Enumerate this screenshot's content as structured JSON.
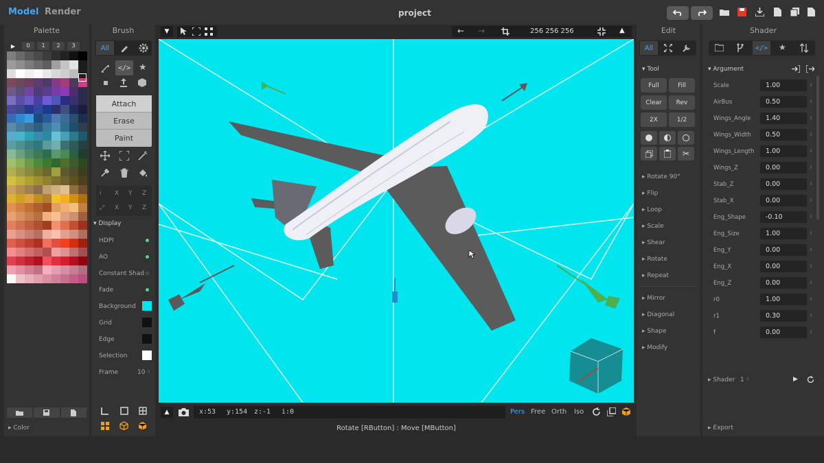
{
  "app": {
    "modes": [
      "Model",
      "Render"
    ],
    "project_title": "project"
  },
  "panels": {
    "palette": "Palette",
    "brush": "Brush",
    "edit": "Edit",
    "shader": "Shader"
  },
  "palette": {
    "pages": [
      "0",
      "1",
      "2",
      "3"
    ],
    "footer": "Color",
    "colors": [
      "#7e7e7e",
      "#6a6a6a",
      "#585858",
      "#4a4a4a",
      "#3c3c3c",
      "#2e2e2e",
      "#222",
      "#111",
      "#000",
      "#9c9c9c",
      "#8e8e8e",
      "#7c7c7c",
      "#6c6c6c",
      "#5e5e5e",
      "#a0a0a0",
      "#c4c4c4",
      "#e2e2e2",
      "#1c1c1c",
      "#dedede",
      "#fff",
      "#f0f0f0",
      "#fafafa",
      "#e8e8e8",
      "#d8d8d8",
      "#cfcfcf",
      "#bdbdbd",
      "#1e1e1e",
      "#7a4a5a",
      "#6a4a5a",
      "#6e3e5e",
      "#5c3e6e",
      "#4e3a6a",
      "#863a86",
      "#a53c7a",
      "#4a3a5c",
      "#d04080",
      "#6c5a8a",
      "#5a4e7a",
      "#6e46a0",
      "#4c3c7a",
      "#5a3e8c",
      "#7a3aa8",
      "#8a3ab2",
      "#4c2e6a",
      "#2e2a4e",
      "#7a6ebe",
      "#5a4eaa",
      "#6a5ac8",
      "#4e3ea0",
      "#6e5cd6",
      "#4a5ab4",
      "#2a2e7e",
      "#3a2e6e",
      "#2a2a4a",
      "#4a4a9a",
      "#3a4a8a",
      "#2a3a8a",
      "#2e4aa0",
      "#1e3a8a",
      "#2e2e6e",
      "#3e4e7e",
      "#1e2a5e",
      "#1a1e3e",
      "#3a6ab0",
      "#2e8ad0",
      "#3e9ae0",
      "#1e4a7e",
      "#2a5a9a",
      "#4a7ab0",
      "#3e6a9a",
      "#2e4e6e",
      "#1e2e4e",
      "#5a8aaa",
      "#4a7a9a",
      "#3e6e8e",
      "#2e5e7e",
      "#3a7a9a",
      "#4e8eae",
      "#2e6e8e",
      "#1e4e6e",
      "#2e3e4e",
      "#5aaad0",
      "#4ab4c8",
      "#2ea0b8",
      "#3a8ab0",
      "#2a8aa0",
      "#6ac0d8",
      "#4aa0b0",
      "#2e7a8a",
      "#1e5a6a",
      "#5aa0a0",
      "#4e9090",
      "#3e8080",
      "#2e7a7a",
      "#5e9a9a",
      "#6eb0b0",
      "#3e7070",
      "#2e5a5a",
      "#2a4040",
      "#8ab89a",
      "#6aa07a",
      "#4e8a6a",
      "#3e7a5a",
      "#2e6e4e",
      "#5a9a6a",
      "#4a8a5a",
      "#2e5e3e",
      "#1e3e2e",
      "#a0c070",
      "#8ab05a",
      "#6a9a4a",
      "#4e8a3e",
      "#3e7a2e",
      "#2e6a2e",
      "#4e6e2e",
      "#3e5a2e",
      "#2e4a1e",
      "#b0b050",
      "#9a9a4a",
      "#8a8a3e",
      "#7a7a2e",
      "#6a6a2e",
      "#a0a03e",
      "#5a5a2e",
      "#4e4e2e",
      "#3e3e1e",
      "#d4c040",
      "#c0b040",
      "#b0a030",
      "#a09030",
      "#908030",
      "#807030",
      "#706030",
      "#605020",
      "#504020",
      "#caa060",
      "#b49050",
      "#a08050",
      "#8a7050",
      "#c0a070",
      "#d0b080",
      "#e0c090",
      "#906e40",
      "#6e5030",
      "#e0b030",
      "#d0a020",
      "#e0a040",
      "#c09020",
      "#b08030",
      "#f0c030",
      "#f0b020",
      "#d09010",
      "#b07010",
      "#e09050",
      "#d08040",
      "#c07030",
      "#b06030",
      "#a05020",
      "#e0a060",
      "#f0b070",
      "#f0c080",
      "#c08040",
      "#e8a070",
      "#d89060",
      "#c88050",
      "#b87040",
      "#f0b080",
      "#f8c090",
      "#e0a080",
      "#d09070",
      "#a06040",
      "#e08060",
      "#d07050",
      "#c06040",
      "#b05030",
      "#a04020",
      "#f09070",
      "#e07050",
      "#c05030",
      "#a03020",
      "#e8a090",
      "#d89080",
      "#c88070",
      "#b87060",
      "#f0b0a0",
      "#f8c0b0",
      "#e0a090",
      "#d09080",
      "#b07060",
      "#e06050",
      "#d05040",
      "#c04030",
      "#b03020",
      "#f07060",
      "#e05040",
      "#f04020",
      "#d03010",
      "#a02010",
      "#f09090",
      "#e08080",
      "#d07070",
      "#c06060",
      "#b05050",
      "#f0a0a0",
      "#e09090",
      "#c07070",
      "#a05050",
      "#e04050",
      "#d03040",
      "#c02030",
      "#b01020",
      "#f05060",
      "#e03040",
      "#d02030",
      "#b01020",
      "#900010",
      "#f0a0b0",
      "#e090a0",
      "#d08090",
      "#c07080",
      "#f0b0c0",
      "#e0a0b0",
      "#d090a0",
      "#c08090",
      "#b07080",
      "#f8f8f8",
      "#f0c0c8",
      "#e8b0b8",
      "#e0a0a8",
      "#d890a0",
      "#d08098",
      "#c87090",
      "#c06088",
      "#b85080"
    ]
  },
  "brush": {
    "tabs": [
      "All"
    ],
    "actions": [
      "Attach",
      "Erase",
      "Paint"
    ],
    "axes1": [
      "X",
      "Y",
      "Z"
    ],
    "axes2": [
      "X",
      "Y",
      "Z"
    ]
  },
  "display": {
    "title": "Display",
    "items": [
      {
        "label": "HDPI"
      },
      {
        "label": "AO"
      },
      {
        "label": "Constant Shad"
      },
      {
        "label": "Fade"
      },
      {
        "label": "Background"
      },
      {
        "label": "Grid"
      },
      {
        "label": "Edge"
      },
      {
        "label": "Selection"
      },
      {
        "label": "Frame",
        "value": "10"
      }
    ],
    "colors": {
      "background": "#00e5ee",
      "grid": "#111111",
      "edge": "#111111",
      "selection": "#ffffff"
    }
  },
  "viewport": {
    "size": "256  256  256",
    "status": {
      "x": "x:53",
      "y": "y:154",
      "z": "z:-1",
      "i": "i:0"
    },
    "views": [
      "Pers",
      "Free",
      "Orth",
      "Iso"
    ],
    "hint": "Rotate [RButton] : Move [MButton]",
    "bg": "#00e5ee"
  },
  "edit": {
    "tab": "All",
    "tool_title": "Tool",
    "tool_buttons": [
      "Full",
      "Fill",
      "Clear",
      "Rev",
      "2X",
      "1/2"
    ],
    "sections": [
      "Rotate 90°",
      "Flip",
      "Loop",
      "Scale",
      "Shear",
      "Rotate",
      "Repeat",
      "Mirror",
      "Diagonal",
      "Shape",
      "Modify"
    ]
  },
  "shader": {
    "argument_title": "Argument",
    "arguments": [
      {
        "name": "Scale",
        "value": "1.00"
      },
      {
        "name": "AirBus",
        "value": "0.50"
      },
      {
        "name": "Wings_Angle",
        "value": "1.40"
      },
      {
        "name": "Wings_Width",
        "value": "0.50"
      },
      {
        "name": "Wings_Length",
        "value": "1.00"
      },
      {
        "name": "Wings_Z",
        "value": "0.00"
      },
      {
        "name": "Stab_Z",
        "value": "0.00"
      },
      {
        "name": "Stab_X",
        "value": "0.00"
      },
      {
        "name": "Eng_Shape",
        "value": "-0.10"
      },
      {
        "name": "Eng_Size",
        "value": "1.00"
      },
      {
        "name": "Eng_Y",
        "value": "0.00"
      },
      {
        "name": "Eng_X",
        "value": "0.00"
      },
      {
        "name": "Eng_Z",
        "value": "0.00"
      },
      {
        "name": "r0",
        "value": "1.00"
      },
      {
        "name": "r1",
        "value": "0.30"
      },
      {
        "name": "f",
        "value": "0.00"
      }
    ],
    "shader_label": "Shader",
    "shader_index": "1",
    "export": "Export"
  },
  "colors": {
    "accent": "#3ea8ff",
    "save": "#e03a2a"
  }
}
